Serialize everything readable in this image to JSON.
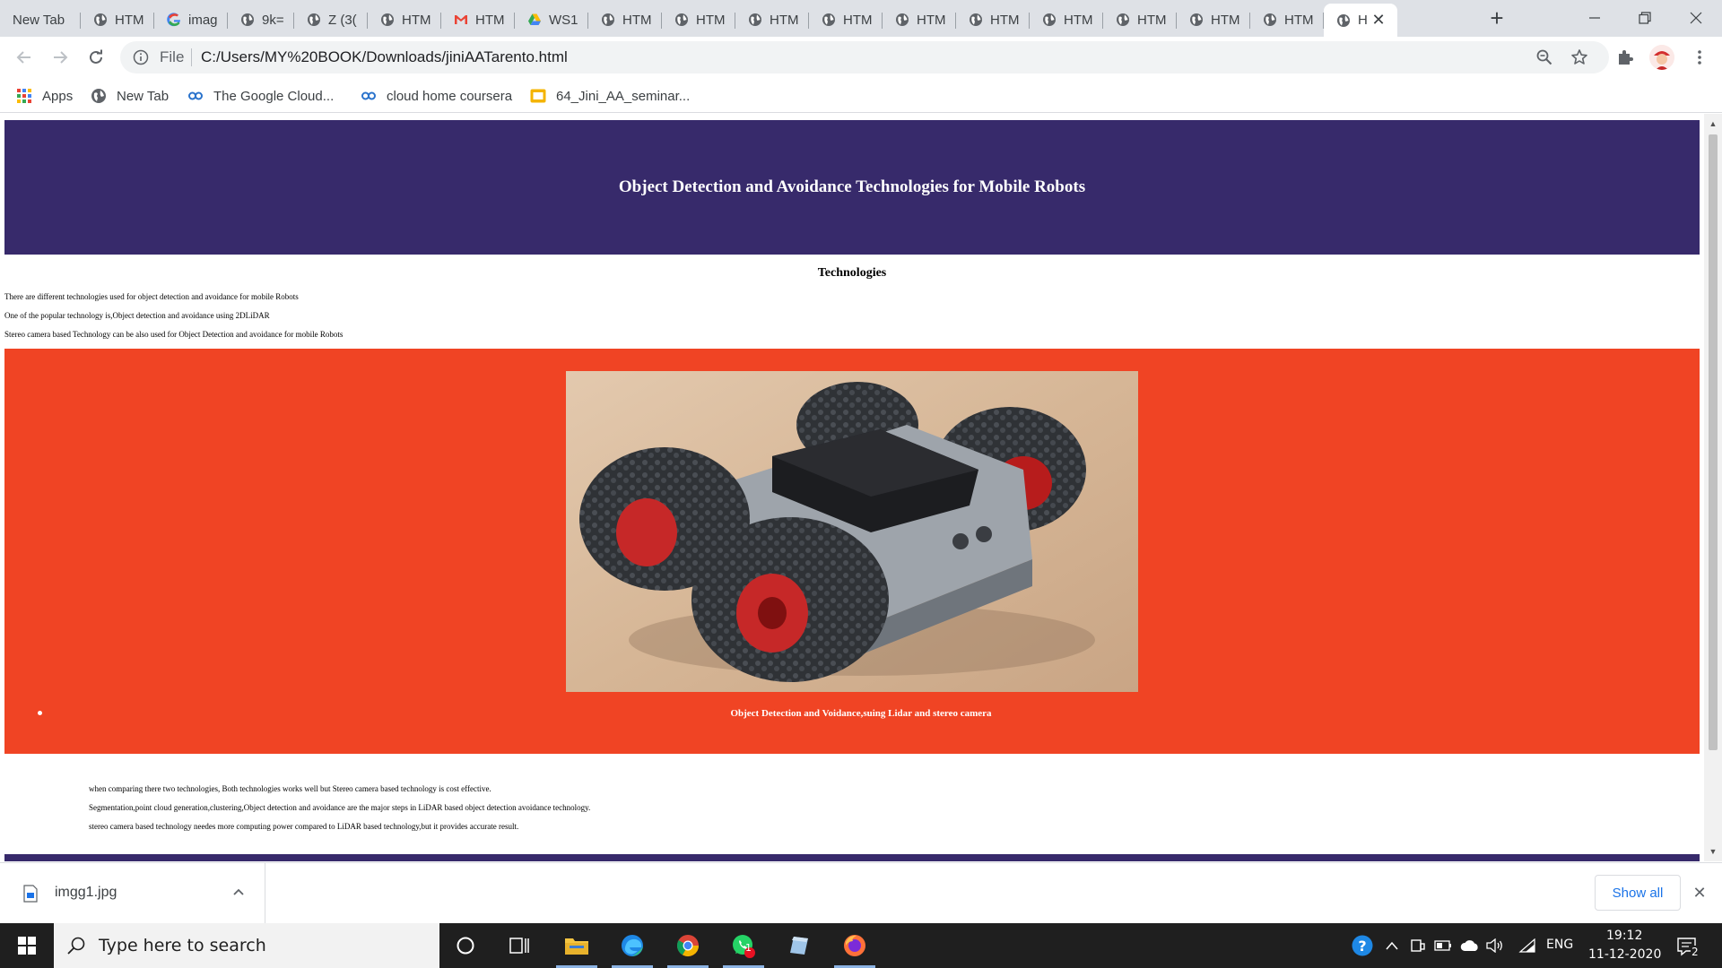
{
  "browser": {
    "tabs": [
      {
        "label": "New Tab",
        "favicon": "none"
      },
      {
        "label": "HTM",
        "favicon": "globe-icon"
      },
      {
        "label": "imag",
        "favicon": "google-icon"
      },
      {
        "label": "9k=",
        "favicon": "globe-icon"
      },
      {
        "label": "Z (3(",
        "favicon": "globe-icon"
      },
      {
        "label": "HTM",
        "favicon": "globe-icon"
      },
      {
        "label": "HTM",
        "favicon": "gmail-icon"
      },
      {
        "label": "WS1",
        "favicon": "drive-icon"
      },
      {
        "label": "HTM",
        "favicon": "globe-icon"
      },
      {
        "label": "HTM",
        "favicon": "globe-icon"
      },
      {
        "label": "HTM",
        "favicon": "globe-icon"
      },
      {
        "label": "HTM",
        "favicon": "globe-icon"
      },
      {
        "label": "HTM",
        "favicon": "globe-icon"
      },
      {
        "label": "HTM",
        "favicon": "globe-icon"
      },
      {
        "label": "HTM",
        "favicon": "globe-icon"
      },
      {
        "label": "HTM",
        "favicon": "globe-icon"
      },
      {
        "label": "HTM",
        "favicon": "globe-icon"
      },
      {
        "label": "HTM",
        "favicon": "globe-icon"
      },
      {
        "label": "H",
        "favicon": "globe-icon",
        "active": true
      }
    ],
    "omnibox": {
      "scheme_label": "File",
      "url": "C:/Users/MY%20BOOK/Downloads/jiniAATarento.html"
    },
    "bookmarks": [
      {
        "label": "Apps",
        "icon": "apps-grid-icon"
      },
      {
        "label": "New Tab",
        "icon": "globe-icon"
      },
      {
        "label": "The Google Cloud...",
        "icon": "coursera-icon"
      },
      {
        "label": "cloud home coursera",
        "icon": "coursera-icon"
      },
      {
        "label": "64_Jini_AA_seminar...",
        "icon": "slides-icon"
      }
    ]
  },
  "page": {
    "header_title": "Object Detection and Avoidance Technologies for Mobile Robots",
    "subheading": "Technologies",
    "intro_lines": [
      "There are different technologies used for object detection and avoidance for mobile Robots",
      "One of the popular technology is,Object detection and avoidance using 2DLiDAR",
      "Stereo camera based Technology can be also used for Object Detection and avoidance for mobile Robots"
    ],
    "image_caption": "Object Detection and Voidance,suing Lidar and stereo camera",
    "comparison_lines": [
      "when comparing there two technologies, Both technologies works well but Stereo camera based technology is cost effective.",
      "Segmentation,point cloud generation,clustering,Object detection and avoidance are the major steps in LiDAR based object detection avoidance technology.",
      "stereo camera based technology needes more computing power compared to LiDAR based technology,but it provides accurate result."
    ],
    "colors": {
      "header_bg": "#372a6b",
      "section_bg": "#f04424"
    }
  },
  "downloads": {
    "file_name": "imgg1.jpg",
    "show_all_label": "Show all"
  },
  "taskbar": {
    "search_placeholder": "Type here to search",
    "notification_badge": "1",
    "language": "ENG",
    "time": "19:12",
    "date": "11-12-2020",
    "action_center_count": "2"
  }
}
